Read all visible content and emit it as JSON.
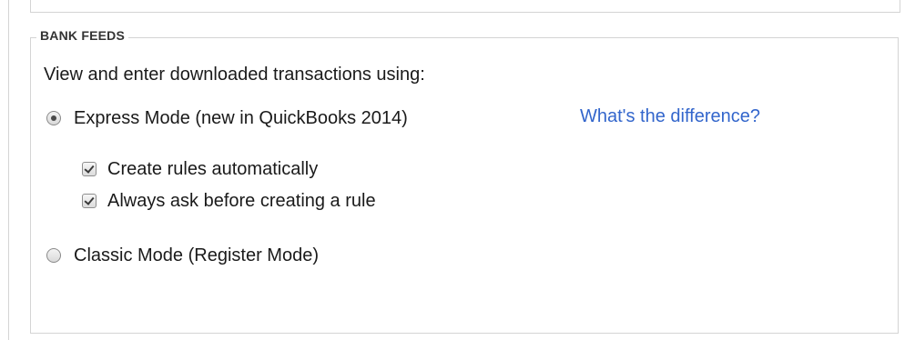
{
  "bank_feeds": {
    "title": "BANK FEEDS",
    "intro": "View and enter downloaded transactions using:",
    "express_mode": {
      "label": "Express Mode (new in QuickBooks 2014)",
      "selected": true
    },
    "difference_link": "What's the difference?",
    "options": {
      "create_rules": {
        "label": "Create rules automatically",
        "checked": true
      },
      "always_ask": {
        "label": "Always ask before creating a rule",
        "checked": true
      }
    },
    "classic_mode": {
      "label": "Classic Mode (Register Mode)",
      "selected": false
    }
  }
}
